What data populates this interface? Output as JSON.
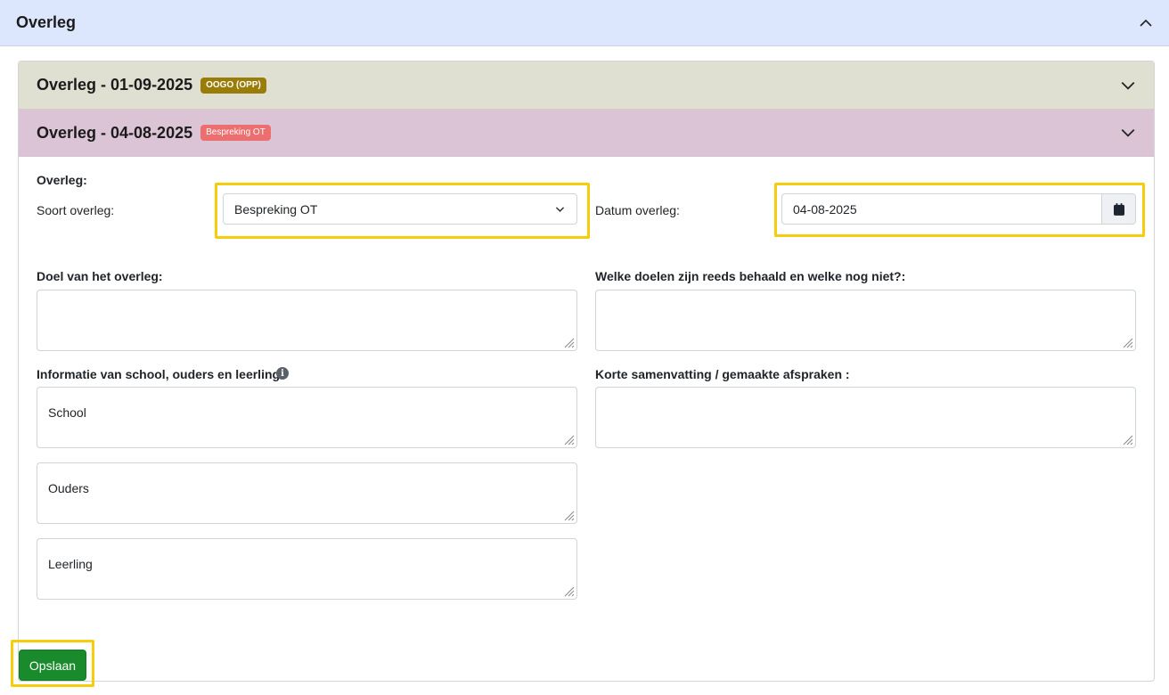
{
  "header": {
    "title": "Overleg"
  },
  "accordion": [
    {
      "title": "Overleg - 01-09-2025",
      "badge": "OOGO (OPP)",
      "badge_color": "#9a7d08",
      "expanded": false
    },
    {
      "title": "Overleg - 04-08-2025",
      "badge": "Bespreking OT",
      "badge_color": "#ec6e6e",
      "expanded": true
    }
  ],
  "form": {
    "section_label": "Overleg:",
    "soort_label": "Soort overleg:",
    "soort_value": "Bespreking OT",
    "datum_label": "Datum overleg:",
    "datum_value": "04-08-2025",
    "doel_label": "Doel van het overleg:",
    "doel_value": "",
    "doelen_label": "Welke doelen zijn reeds behaald en welke nog niet?:",
    "doelen_value": "",
    "informatie_label": "Informatie van school, ouders en leerling",
    "info_icon_glyph": "i",
    "samenvatting_label": "Korte samenvatting / gemaakte afspraken :",
    "samenvatting_value": "",
    "school_value": "School",
    "ouders_value": "Ouders",
    "leerling_value": "Leerling",
    "save_label": "Opslaan"
  },
  "colors": {
    "header_bg": "#dce6fd",
    "accordion_one_bg": "#dfe0d2",
    "accordion_two_bg": "#dcc4d7",
    "highlight": "#f6cd0b",
    "save_button": "#198b2c"
  }
}
